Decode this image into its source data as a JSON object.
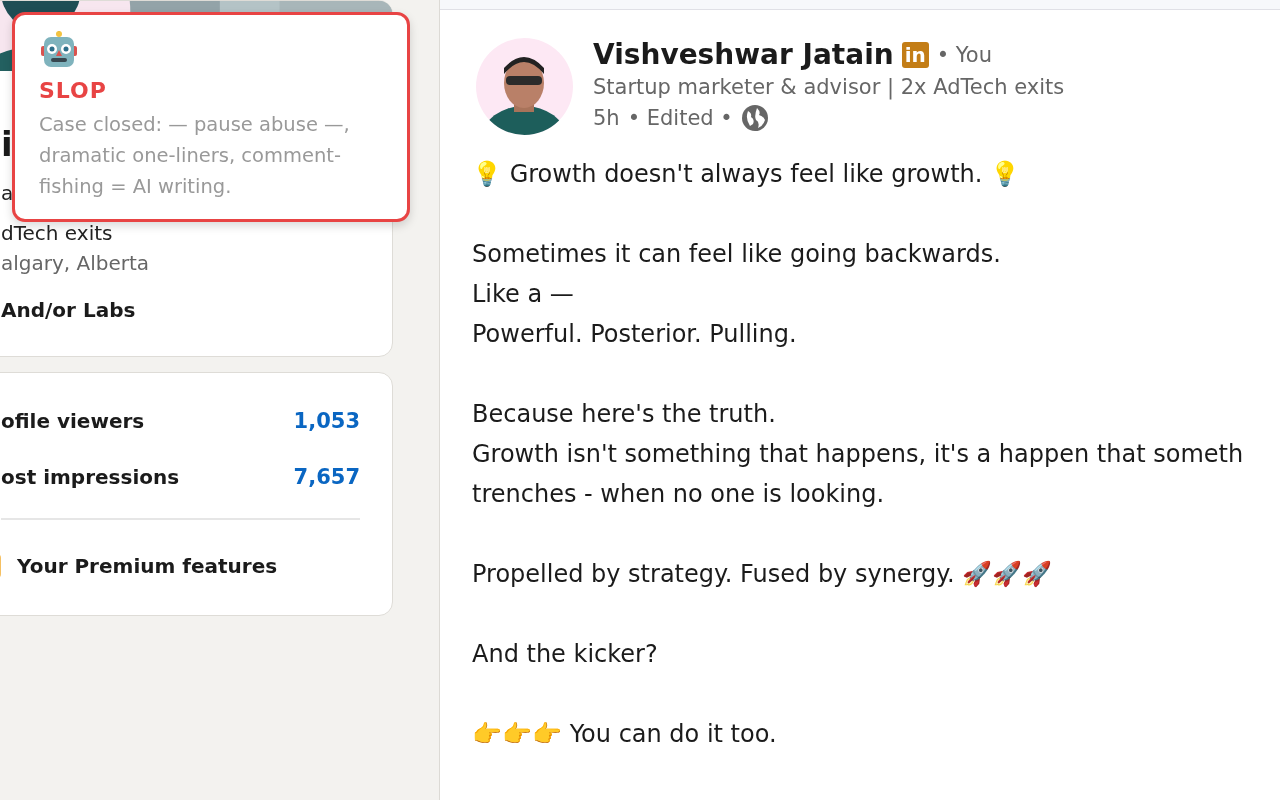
{
  "profile_card": {
    "name": "i",
    "headline_lines": [
      "a",
      "dTech exits"
    ],
    "location": "algary, Alberta",
    "company": "And/or Labs"
  },
  "stats_card": {
    "stats": [
      {
        "label": "ofile viewers",
        "value": "1,053"
      },
      {
        "label": "ost impressions",
        "value": "7,657"
      }
    ],
    "premium": "Your Premium features"
  },
  "tooltip": {
    "verdict": "SLOP",
    "explanation": "Case closed: — pause abuse —, dramatic one-liners, comment-fishing = AI writing."
  },
  "post": {
    "author": "Vishveshwar Jatain",
    "badge": "in",
    "relation": "• You",
    "headline": "Startup marketer & advisor | 2x AdTech exits",
    "time": "5h",
    "edited": "• Edited •",
    "paragraphs": [
      [
        "💡 Growth doesn't always feel like growth. 💡"
      ],
      [
        "Sometimes it can feel like going backwards.",
        "Like a —",
        "Powerful. Posterior. Pulling."
      ],
      [
        "Because here's the truth.",
        "Growth isn't something that happens, it's a happen that someth",
        "trenches - when no one is looking."
      ],
      [
        "Propelled by strategy. Fused by synergy. 🚀🚀🚀"
      ],
      [
        "And the kicker?"
      ],
      [
        "👉👉👉 You can do it too."
      ]
    ]
  }
}
